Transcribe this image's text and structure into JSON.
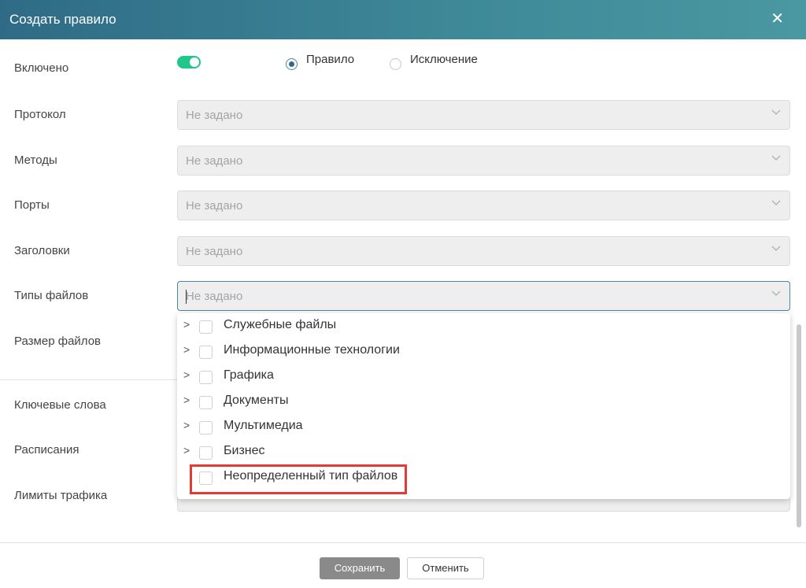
{
  "dialog": {
    "title": "Создать правило",
    "close_glyph": "✕"
  },
  "fields": {
    "enabled": "Включено",
    "protocol": "Протокол",
    "methods": "Методы",
    "ports": "Порты",
    "headers": "Заголовки",
    "file_types": "Типы файлов",
    "file_size": "Размер файлов",
    "keywords": "Ключевые слова",
    "schedules": "Расписания",
    "traffic_limits": "Лимиты трафика"
  },
  "enabled_toggle": {
    "on": true
  },
  "rule_type": {
    "rule_label": "Правило",
    "exception_label": "Исключение",
    "selected": "rule"
  },
  "placeholder": "Не задано",
  "file_types_dropdown": {
    "items": [
      {
        "label": "Служебные файлы",
        "expandable": true,
        "checked": false
      },
      {
        "label": "Информационные технологии",
        "expandable": true,
        "checked": false
      },
      {
        "label": "Графика",
        "expandable": true,
        "checked": false
      },
      {
        "label": "Документы",
        "expandable": true,
        "checked": false
      },
      {
        "label": "Мультимедиа",
        "expandable": true,
        "checked": false
      },
      {
        "label": "Бизнес",
        "expandable": true,
        "checked": false
      },
      {
        "label": "Неопределенный тип файлов",
        "expandable": false,
        "checked": false,
        "highlighted": true
      }
    ],
    "expander_glyph": ">"
  },
  "buttons": {
    "save": "Сохранить",
    "cancel": "Отменить"
  },
  "colors": {
    "header": "#2f6b86",
    "toggle_on": "#1fc78a",
    "highlight": "#e53935"
  }
}
